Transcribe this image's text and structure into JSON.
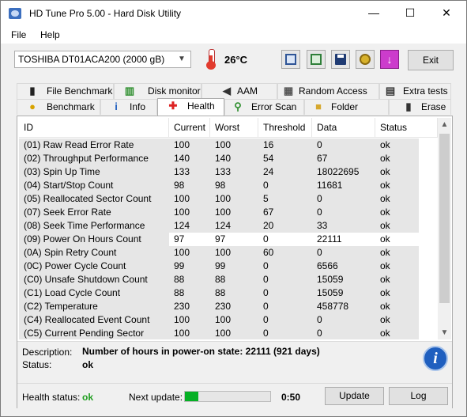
{
  "window": {
    "title": "HD Tune Pro 5.00 - Hard Disk Utility",
    "minimize": "—",
    "maximize": "☐",
    "close": "✕"
  },
  "menu": {
    "file": "File",
    "help": "Help"
  },
  "toolbar": {
    "drive": "TOSHIBA DT01ACA200 (2000 gB)",
    "temperature": "26°C",
    "exit_label": "Exit",
    "down_glyph": "↓"
  },
  "tabs": {
    "row1": [
      {
        "label": "File Benchmark",
        "icon": "file-benchmark-icon"
      },
      {
        "label": "Disk monitor",
        "icon": "disk-monitor-icon"
      },
      {
        "label": "AAM",
        "icon": "speaker-icon"
      },
      {
        "label": "Random Access",
        "icon": "random-access-icon"
      },
      {
        "label": "Extra tests",
        "icon": "extra-tests-icon"
      }
    ],
    "row2": [
      {
        "label": "Benchmark",
        "icon": "benchmark-icon"
      },
      {
        "label": "Info",
        "icon": "info-icon"
      },
      {
        "label": "Health",
        "icon": "health-cross-icon",
        "active": true
      },
      {
        "label": "Error Scan",
        "icon": "magnifier-icon"
      },
      {
        "label": "Folder Usage",
        "icon": "folder-icon"
      },
      {
        "label": "Erase",
        "icon": "trash-icon"
      }
    ]
  },
  "health": {
    "columns": [
      "ID",
      "Current",
      "Worst",
      "Threshold",
      "Data",
      "Status"
    ],
    "rows": [
      [
        "(01) Raw Read Error Rate",
        "100",
        "100",
        "16",
        "0",
        "ok"
      ],
      [
        "(02) Throughput Performance",
        "140",
        "140",
        "54",
        "67",
        "ok"
      ],
      [
        "(03) Spin Up Time",
        "133",
        "133",
        "24",
        "18022695",
        "ok"
      ],
      [
        "(04) Start/Stop Count",
        "98",
        "98",
        "0",
        "11681",
        "ok"
      ],
      [
        "(05) Reallocated Sector Count",
        "100",
        "100",
        "5",
        "0",
        "ok"
      ],
      [
        "(07) Seek Error Rate",
        "100",
        "100",
        "67",
        "0",
        "ok"
      ],
      [
        "(08) Seek Time Performance",
        "124",
        "124",
        "20",
        "33",
        "ok"
      ],
      [
        "(09) Power On Hours Count",
        "97",
        "97",
        "0",
        "22111",
        "ok"
      ],
      [
        "(0A) Spin Retry Count",
        "100",
        "100",
        "60",
        "0",
        "ok"
      ],
      [
        "(0C) Power Cycle Count",
        "99",
        "99",
        "0",
        "6566",
        "ok"
      ],
      [
        "(C0) Unsafe Shutdown Count",
        "88",
        "88",
        "0",
        "15059",
        "ok"
      ],
      [
        "(C1) Load Cycle Count",
        "88",
        "88",
        "0",
        "15059",
        "ok"
      ],
      [
        "(C2) Temperature",
        "230",
        "230",
        "0",
        "458778",
        "ok"
      ],
      [
        "(C4) Reallocated Event Count",
        "100",
        "100",
        "0",
        "0",
        "ok"
      ],
      [
        "(C5) Current Pending Sector",
        "100",
        "100",
        "0",
        "0",
        "ok"
      ]
    ],
    "selected_row": 7,
    "description_label": "Description:",
    "description": "Number of hours in power-on state: 22111 (921 days)",
    "status_label": "Status:",
    "status": "ok"
  },
  "footer": {
    "health_status_label": "Health status:",
    "health_status": "ok",
    "next_update_label": "Next update:",
    "next_update_progress": 0.16,
    "next_update_time": "0:50",
    "update_button": "Update",
    "log_button": "Log"
  },
  "colors": {
    "accent": "#06b025",
    "ok_text": "#1f9e1f",
    "info_blue": "#1f5fbf",
    "title_bg": "#ffffff"
  }
}
